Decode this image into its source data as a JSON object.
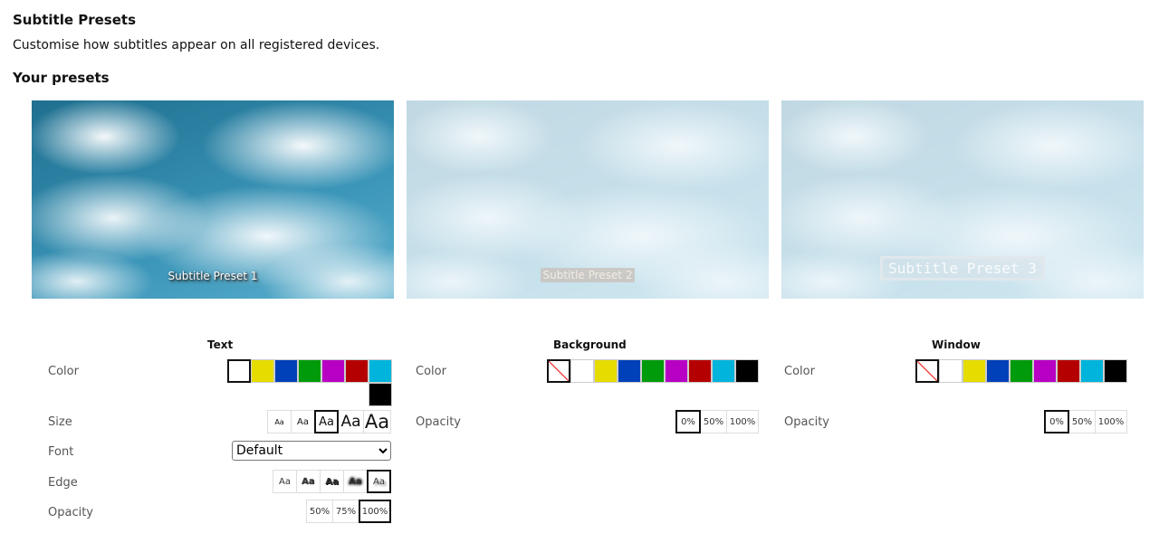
{
  "page": {
    "title": "Subtitle Presets",
    "subtitle": "Customise how subtitles appear on all registered devices.",
    "presets_heading": "Your presets"
  },
  "presets": [
    {
      "caption": "Subtitle Preset 1"
    },
    {
      "caption": "Subtitle Preset 2"
    },
    {
      "caption": "Subtitle Preset 3"
    }
  ],
  "text_panel": {
    "title": "Text",
    "color_label": "Color",
    "colors": [
      {
        "name": "white",
        "hex": "#ffffff",
        "selected": true
      },
      {
        "name": "yellow",
        "hex": "#e6dc00"
      },
      {
        "name": "blue",
        "hex": "#0041b9"
      },
      {
        "name": "green",
        "hex": "#009b0b"
      },
      {
        "name": "magenta",
        "hex": "#b800c4"
      },
      {
        "name": "red",
        "hex": "#b40000"
      },
      {
        "name": "cyan",
        "hex": "#00b4dc"
      },
      {
        "name": "black",
        "hex": "#000000"
      }
    ],
    "size_label": "Size",
    "sizes": [
      "Aa",
      "Aa",
      "Aa",
      "Aa",
      "Aa"
    ],
    "size_selected_index": 2,
    "font_label": "Font",
    "font_value": "Default",
    "edge_label": "Edge",
    "edges": [
      "Aa",
      "Aa",
      "Aa",
      "Aa",
      "Aa"
    ],
    "edge_selected_index": 4,
    "opacity_label": "Opacity",
    "opacities": [
      "50%",
      "75%",
      "100%"
    ],
    "opacity_selected_index": 2
  },
  "background_panel": {
    "title": "Background",
    "color_label": "Color",
    "opacity_label": "Opacity",
    "opacities": [
      "0%",
      "50%",
      "100%"
    ],
    "opacity_selected_index": 0
  },
  "window_panel": {
    "title": "Window",
    "color_label": "Color",
    "opacity_label": "Opacity",
    "opacities": [
      "0%",
      "50%",
      "100%"
    ],
    "opacity_selected_index": 0
  },
  "bg_colors": [
    {
      "name": "none",
      "hex": "none",
      "selected": true
    },
    {
      "name": "white",
      "hex": "#ffffff"
    },
    {
      "name": "yellow",
      "hex": "#e6dc00"
    },
    {
      "name": "blue",
      "hex": "#0041b9"
    },
    {
      "name": "green",
      "hex": "#009b0b"
    },
    {
      "name": "magenta",
      "hex": "#b800c4"
    },
    {
      "name": "red",
      "hex": "#b40000"
    },
    {
      "name": "cyan",
      "hex": "#00b4dc"
    },
    {
      "name": "black",
      "hex": "#000000"
    }
  ]
}
